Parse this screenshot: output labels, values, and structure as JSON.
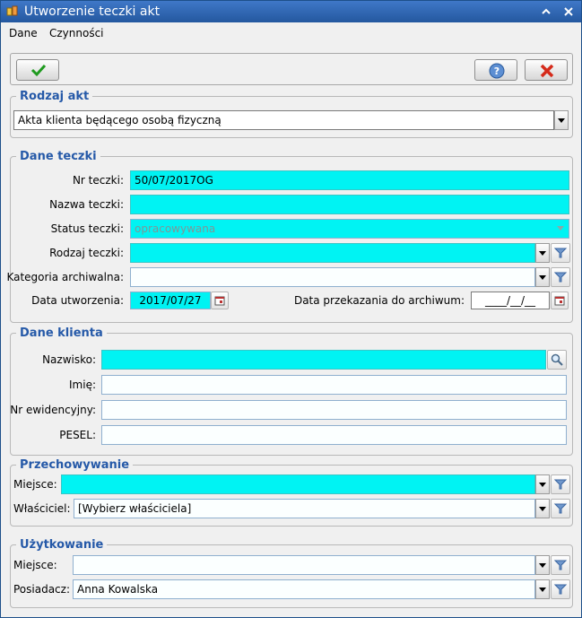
{
  "window": {
    "title": "Utworzenie teczki akt"
  },
  "menu": {
    "items": [
      "Dane",
      "Czynności"
    ]
  },
  "rodzaj_akt": {
    "legend": "Rodzaj akt",
    "value": "Akta klienta będącego osobą fizyczną"
  },
  "dane_teczki": {
    "legend": "Dane teczki",
    "nr_teczki": {
      "label": "Nr teczki:",
      "value": "50/07/2017OG"
    },
    "nazwa_teczki": {
      "label": "Nazwa teczki:",
      "value": ""
    },
    "status_teczki": {
      "label": "Status teczki:",
      "value": "opracowywana"
    },
    "rodzaj_teczki": {
      "label": "Rodzaj teczki:",
      "value": ""
    },
    "kategoria": {
      "label": "Kategoria archiwalna:",
      "value": ""
    },
    "data_utworzenia": {
      "label": "Data utworzenia:",
      "value": "2017/07/27"
    },
    "data_przekazania": {
      "label": "Data przekazania do archiwum:",
      "value": "____/__/__"
    }
  },
  "dane_klienta": {
    "legend": "Dane klienta",
    "nazwisko": {
      "label": "Nazwisko:",
      "value": ""
    },
    "imie": {
      "label": "Imię:",
      "value": ""
    },
    "nr_ewid": {
      "label": "Nr ewidencyjny:",
      "value": ""
    },
    "pesel": {
      "label": "PESEL:",
      "value": ""
    }
  },
  "przechowywanie": {
    "legend": "Przechowywanie",
    "miejsce": {
      "label": "Miejsce:",
      "value": ""
    },
    "wlasciciel": {
      "label": "Właściciel:",
      "value": "[Wybierz właściciela]"
    }
  },
  "uzytkowanie": {
    "legend": "Użytkowanie",
    "miejsce": {
      "label": "Miejsce:",
      "value": ""
    },
    "posiadacz": {
      "label": "Posiadacz:",
      "value": "Anna Kowalska"
    }
  },
  "icons": {
    "accept": "checkmark-icon",
    "help": "help-icon",
    "cancel": "cancel-x-icon",
    "search": "magnifier-icon",
    "calendar": "calendar-icon",
    "filter": "filter-icon"
  },
  "colors": {
    "required": "#00f3f3",
    "legend": "#2559a8",
    "titlebar": "#2f67b4"
  }
}
